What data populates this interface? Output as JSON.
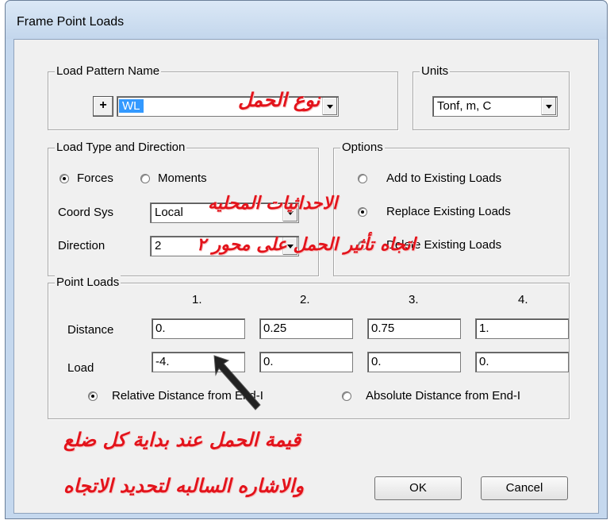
{
  "window": {
    "title": "Frame Point Loads"
  },
  "load_pattern": {
    "legend": "Load Pattern Name",
    "add_label": "+",
    "value": "WL"
  },
  "units": {
    "legend": "Units",
    "value": "Tonf, m, C"
  },
  "load_type": {
    "legend": "Load Type and Direction",
    "forces_label": "Forces",
    "forces_selected": true,
    "moments_label": "Moments",
    "moments_selected": false,
    "coord_sys_label": "Coord Sys",
    "coord_sys_value": "Local",
    "direction_label": "Direction",
    "direction_value": "2"
  },
  "options": {
    "legend": "Options",
    "items": [
      {
        "label": "Add to Existing Loads",
        "selected": false
      },
      {
        "label": "Replace Existing Loads",
        "selected": true
      },
      {
        "label": "Delete Existing Loads",
        "selected": false
      }
    ]
  },
  "point_loads": {
    "legend": "Point Loads",
    "columns": [
      "1.",
      "2.",
      "3.",
      "4."
    ],
    "distance_label": "Distance",
    "distance_values": [
      "0.",
      "0.25",
      "0.75",
      "1."
    ],
    "load_label": "Load",
    "load_values": [
      "-4.",
      "0.",
      "0.",
      "0."
    ],
    "relative_label": "Relative Distance from End-I",
    "relative_selected": true,
    "absolute_label": "Absolute Distance from End-I",
    "absolute_selected": false
  },
  "buttons": {
    "ok": "OK",
    "cancel": "Cancel"
  },
  "annotations": {
    "load_type_note": "نوع الحمل",
    "local_coords_note": "الاحداثيات المحليه",
    "direction_note": "اتجاه تأثير الحمل على محور ٢",
    "value_note": "قيمة الحمل عند بداية كل ضلع",
    "sign_note": "والاشاره السالبه لتحديد الاتجاه",
    "color": "#e3131b"
  },
  "colors": {
    "title_bar": "#c5d8ee",
    "selection": "#3399ff",
    "face": "#f0f0f0"
  }
}
